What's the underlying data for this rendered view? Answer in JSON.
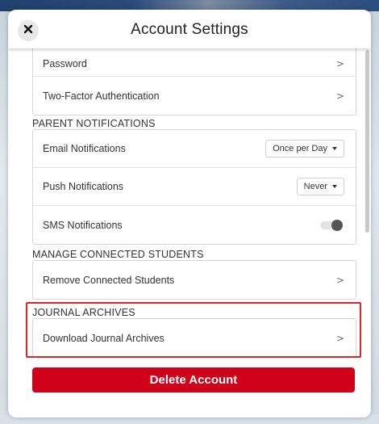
{
  "modal": {
    "title": "Account Settings"
  },
  "security": {
    "rows": [
      {
        "label": "Password"
      },
      {
        "label": "Two-Factor Authentication"
      }
    ]
  },
  "parent_notifications": {
    "header": "PARENT NOTIFICATIONS",
    "email_label": "Email Notifications",
    "email_value": "Once per Day",
    "push_label": "Push Notifications",
    "push_value": "Never",
    "sms_label": "SMS Notifications",
    "sms_enabled": false
  },
  "manage_students": {
    "header": "MANAGE CONNECTED STUDENTS",
    "remove_label": "Remove Connected Students"
  },
  "journal_archives": {
    "header": "JOURNAL ARCHIVES",
    "download_label": "Download Journal Archives"
  },
  "chevron": ">",
  "delete_label": "Delete Account",
  "colors": {
    "danger": "#d0021b",
    "highlight": "#d9262c"
  }
}
